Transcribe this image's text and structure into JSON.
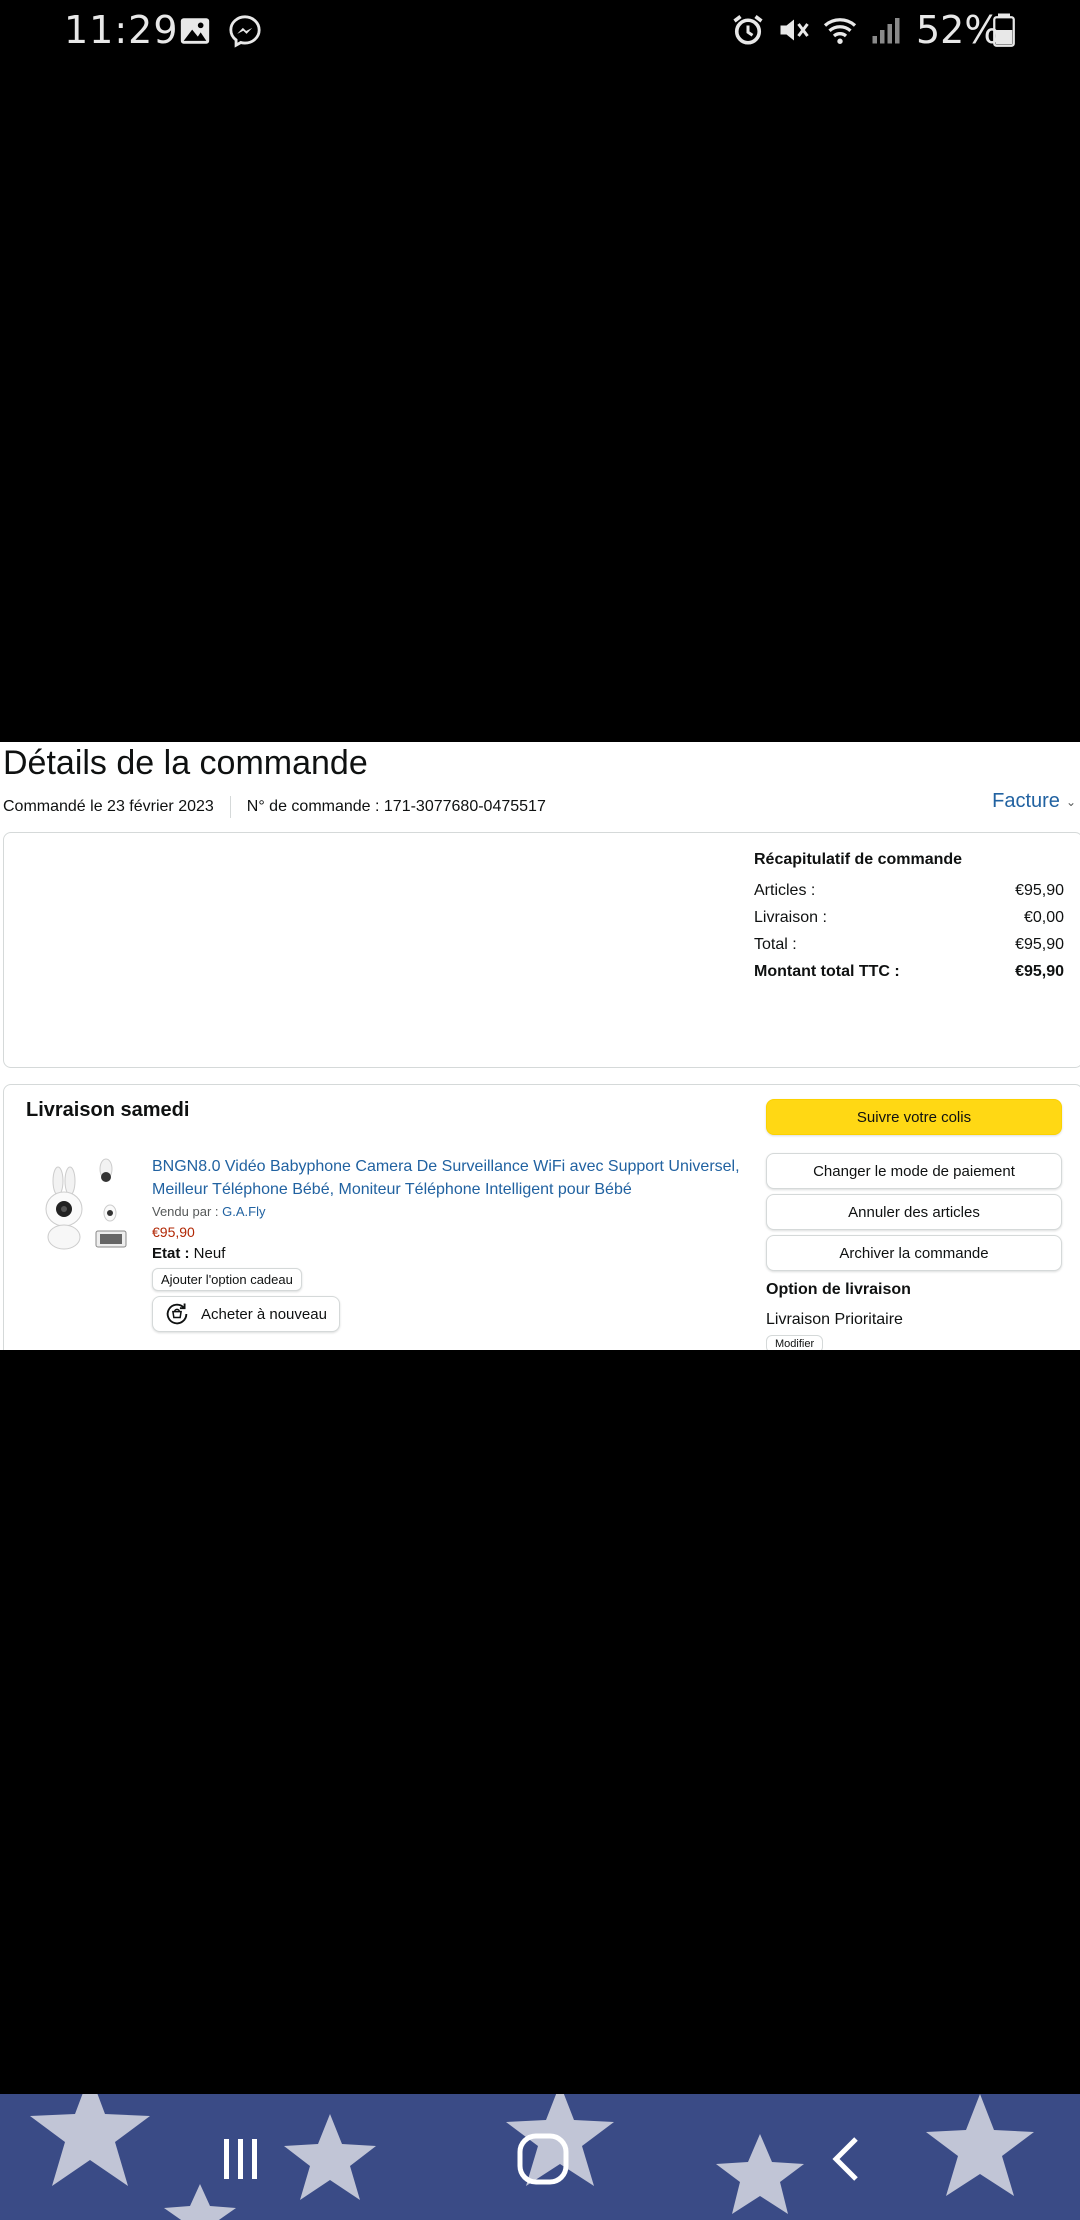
{
  "status_bar": {
    "time": "11:29",
    "battery_percent": "52%",
    "left_icons": [
      "gallery-icon",
      "messenger-icon"
    ],
    "right_icons": [
      "alarm-icon",
      "mute-icon",
      "wifi-icon",
      "signal-icon",
      "battery-icon"
    ],
    "battery_level": 0.52
  },
  "page": {
    "title": "Détails de la commande",
    "ordered_on": "Commandé le 23 février 2023",
    "order_number": "N° de commande : 171-3077680-0475517",
    "invoice_label": "Facture",
    "invoice_caret": "⌄"
  },
  "summary": {
    "title": "Récapitulatif de commande",
    "rows": [
      {
        "label": "Articles :",
        "value": "€95,90"
      },
      {
        "label": "Livraison :",
        "value": "€0,00"
      },
      {
        "label": "Total :",
        "value": "€95,90"
      },
      {
        "label": "Montant total TTC :",
        "value": "€95,90"
      }
    ]
  },
  "delivery": {
    "title": "Livraison samedi",
    "product": {
      "title": "BNGN8.0 Vidéo Babyphone Camera De Surveillance WiFi avec Support Universel, Meilleur Téléphone Bébé, Moniteur Téléphone Intelligent pour Bébé",
      "sold_by_label": "Vendu par : ",
      "sold_by": "G.A.Fly",
      "price": "€95,90",
      "condition_label": "Etat :",
      "condition": "Neuf",
      "gift_button": "Ajouter l'option cadeau",
      "rebuy_button": "Acheter à nouveau"
    },
    "actions": {
      "track": "Suivre votre colis",
      "change_payment": "Changer le mode de paiement",
      "cancel_items": "Annuler des articles",
      "archive": "Archiver la commande"
    },
    "shipping_option_title": "Option de livraison",
    "shipping_option": "Livraison Prioritaire",
    "modify_button": "Modifier"
  },
  "colors": {
    "link": "#2162a1",
    "price": "#b12704",
    "primary_button": "#ffd814",
    "border": "#d5d9d9"
  },
  "nav_bar": {
    "buttons": [
      "recents-icon",
      "home-icon",
      "back-icon"
    ]
  }
}
